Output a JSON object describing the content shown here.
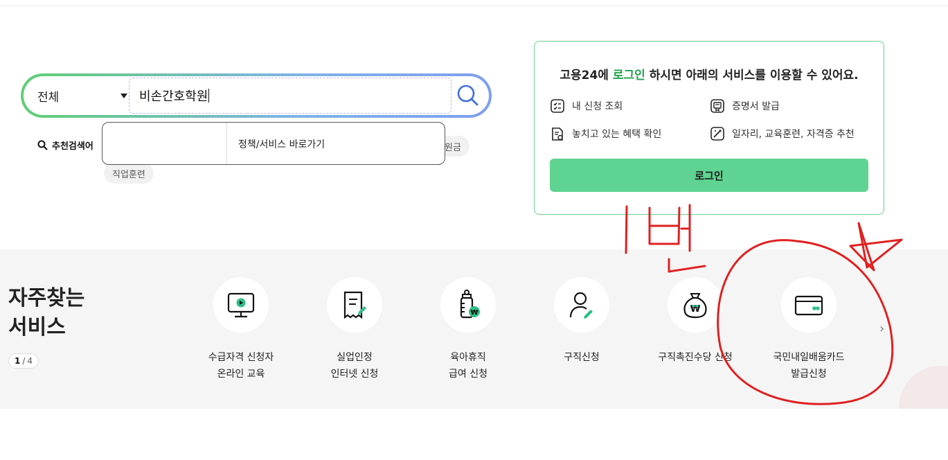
{
  "search": {
    "category": "전체",
    "query": "비손간호학원",
    "recommend_label": "추천검색어",
    "chips": [
      "원금",
      "직업훈련"
    ],
    "dropdown_link": "정책/서비스 바로가기"
  },
  "login": {
    "title_prefix": "고용24에 ",
    "title_highlight": "로그인",
    "title_suffix": " 하시면 아래의 서비스를 이용할 수 있어요.",
    "services": [
      {
        "label": "내 신청 조회",
        "icon": "checklist-icon"
      },
      {
        "label": "증명서 발급",
        "icon": "certificate-icon"
      },
      {
        "label": "놓치고 있는 혜택 확인",
        "icon": "benefit-doc-icon"
      },
      {
        "label": "일자리, 교육훈련, 자격증 추천",
        "icon": "magic-wand-icon"
      }
    ],
    "button": "로그인"
  },
  "frequent": {
    "title_line1": "자주찾는",
    "title_line2": "서비스",
    "page_current": "1",
    "page_sep": "/",
    "page_total": "4",
    "items": [
      {
        "line1": "수급자격 신청자",
        "line2": "온라인 교육",
        "icon": "monitor-play-icon"
      },
      {
        "line1": "실업인정",
        "line2": "인터넷 신청",
        "icon": "document-pen-icon"
      },
      {
        "line1": "육아휴직",
        "line2": "급여 신청",
        "icon": "baby-bottle-icon"
      },
      {
        "line1": "구직신청",
        "line2": "",
        "icon": "person-pen-icon"
      },
      {
        "line1": "구직촉진수당 신청",
        "line2": "",
        "icon": "money-bag-icon"
      },
      {
        "line1": "국민내일배움카드",
        "line2": "발급신청",
        "icon": "card-icon"
      }
    ]
  },
  "annotation": {
    "color": "#e02020",
    "handwriting": "1번"
  },
  "colors": {
    "accent_green": "#23a04d",
    "login_button": "#5fd391"
  }
}
